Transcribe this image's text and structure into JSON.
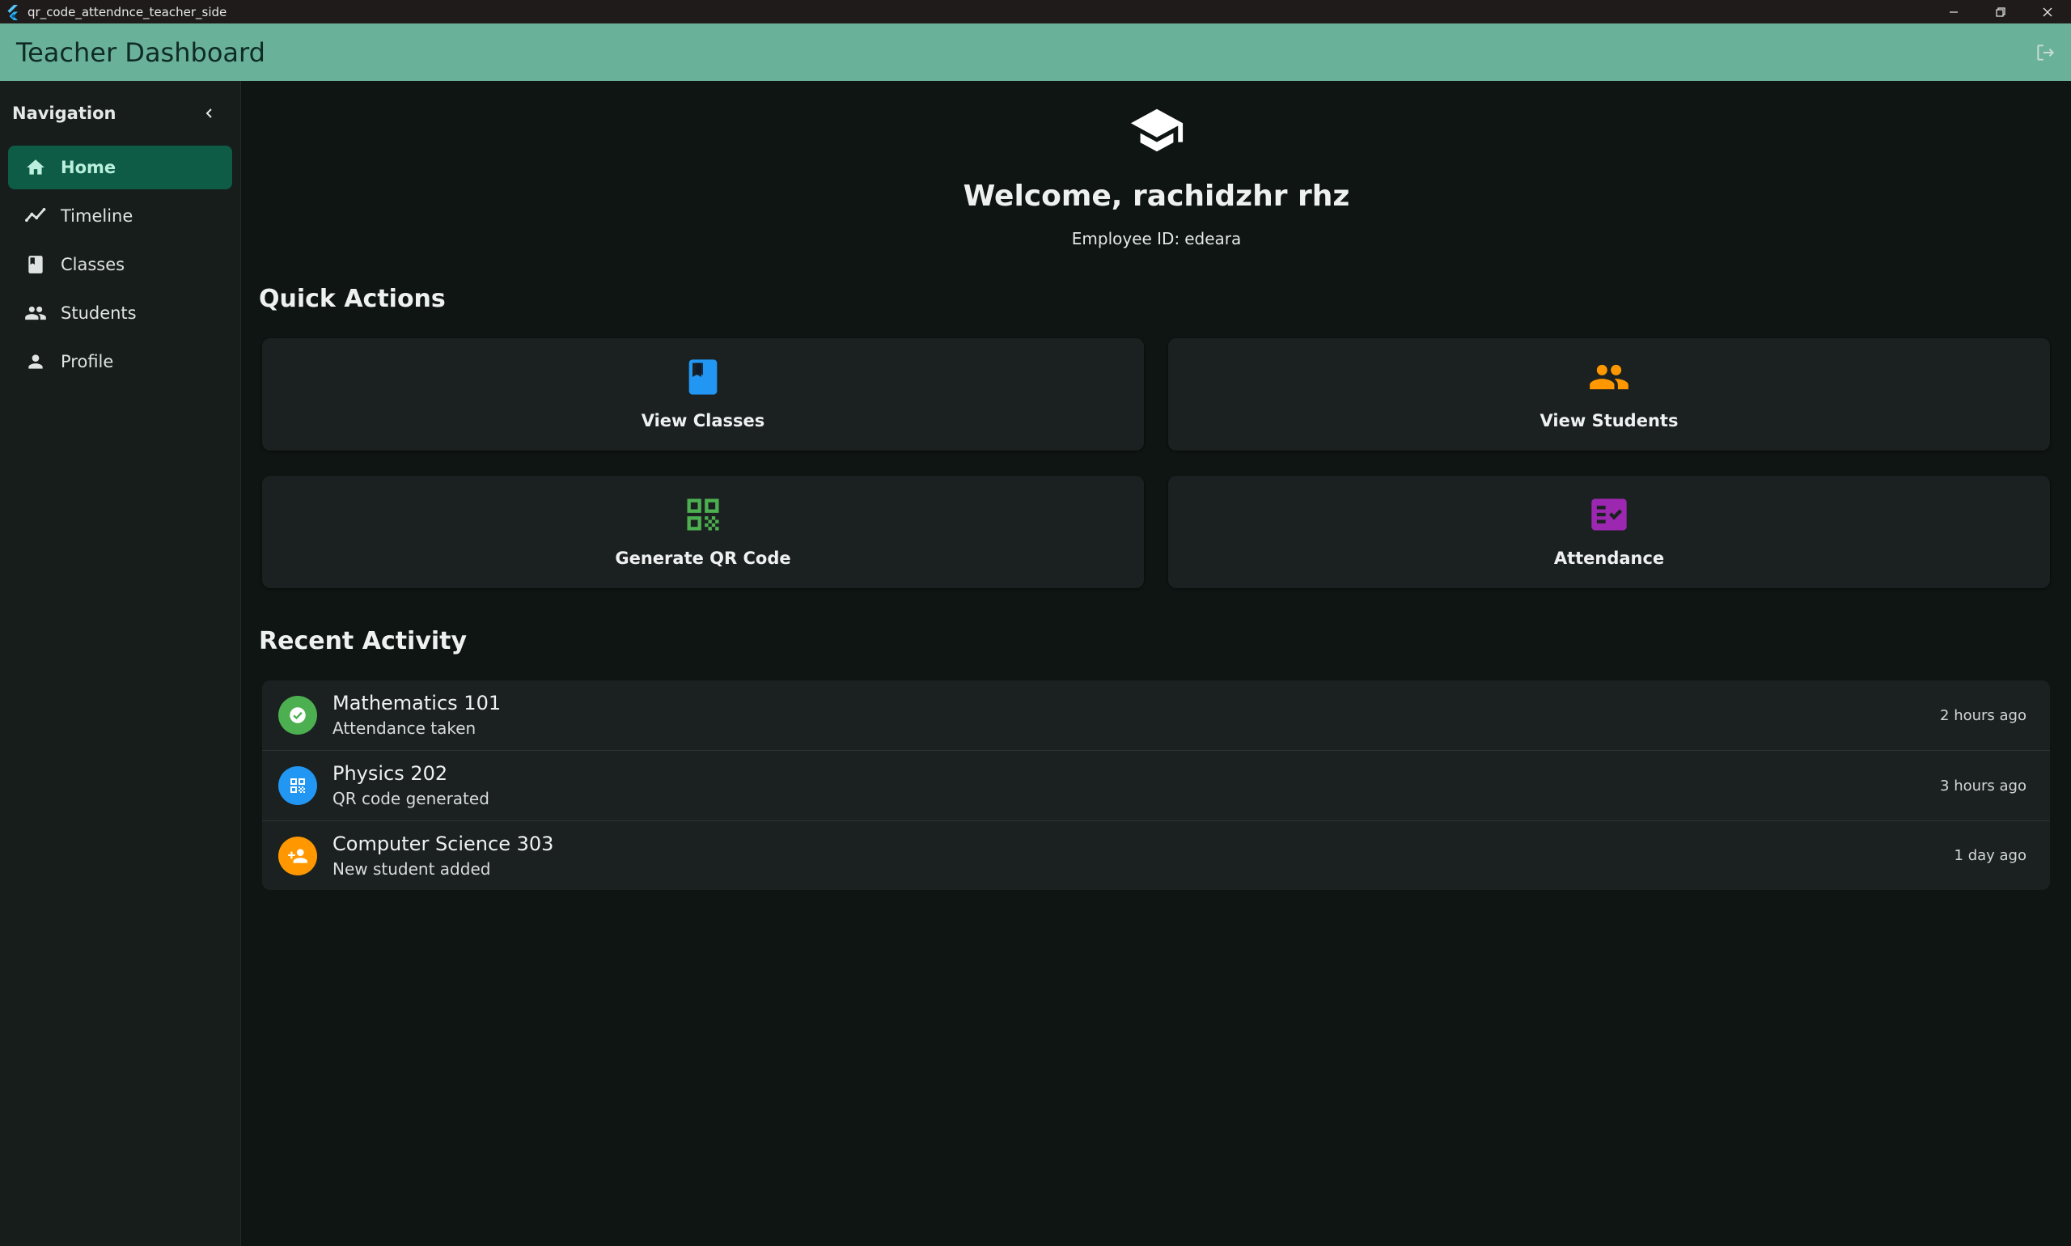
{
  "window": {
    "title": "qr_code_attendnce_teacher_side"
  },
  "appbar": {
    "title": "Teacher Dashboard",
    "logout_icon": "logout-icon"
  },
  "sidebar": {
    "title": "Navigation",
    "items": [
      {
        "label": "Home",
        "icon": "home-icon",
        "active": true
      },
      {
        "label": "Timeline",
        "icon": "timeline-icon",
        "active": false
      },
      {
        "label": "Classes",
        "icon": "book-icon",
        "active": false
      },
      {
        "label": "Students",
        "icon": "people-icon",
        "active": false
      },
      {
        "label": "Profile",
        "icon": "person-icon",
        "active": false
      }
    ]
  },
  "welcome": {
    "title": "Welcome, rachidzhr rhz",
    "employee_label": "Employee ID:",
    "employee_id": "edeara"
  },
  "quick_actions": {
    "title": "Quick Actions",
    "items": [
      {
        "label": "View Classes",
        "icon": "book-icon",
        "color": "#2196f3"
      },
      {
        "label": "View Students",
        "icon": "people-icon",
        "color": "#ff9800"
      },
      {
        "label": "Generate QR Code",
        "icon": "qr-code-icon",
        "color": "#4caf50"
      },
      {
        "label": "Attendance",
        "icon": "fact-check-icon",
        "color": "#9c27b0"
      }
    ]
  },
  "recent_activity": {
    "title": "Recent Activity",
    "items": [
      {
        "title": "Mathematics 101",
        "subtitle": "Attendance taken",
        "time": "2 hours ago",
        "icon": "check-circle-icon",
        "color": "#4caf50"
      },
      {
        "title": "Physics 202",
        "subtitle": "QR code generated",
        "time": "3 hours ago",
        "icon": "qr-code-icon",
        "color": "#2196f3"
      },
      {
        "title": "Computer Science 303",
        "subtitle": "New student added",
        "time": "1 day ago",
        "icon": "person-add-icon",
        "color": "#ff9800"
      }
    ]
  },
  "colors": {
    "appbar": "#6ab19a",
    "active_nav": "#0f5c46",
    "background": "#0e1513",
    "card": "#1b2120"
  }
}
